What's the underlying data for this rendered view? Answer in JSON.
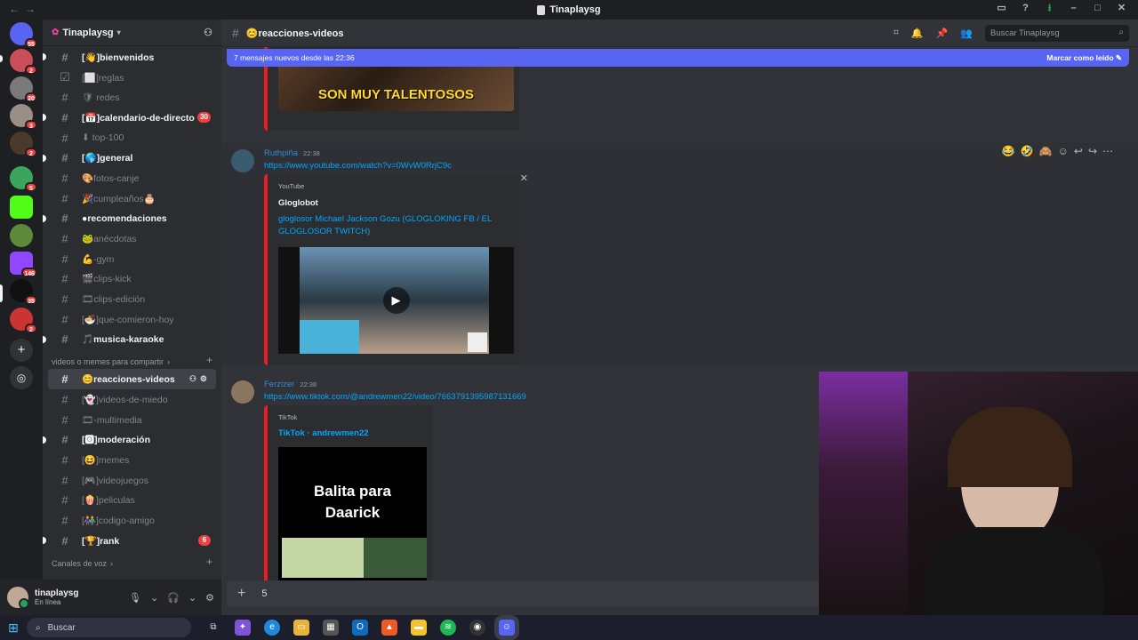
{
  "window": {
    "title": "Tinaplaysg"
  },
  "guild_badges": [
    "55",
    "2",
    "20",
    "3",
    "2",
    "5",
    "146",
    "35",
    "2"
  ],
  "server": {
    "name": "Tinaplaysg"
  },
  "channels_a": [
    {
      "name": "[👋]bienvenidos",
      "unread": true
    },
    {
      "name": "[⬜]reglas",
      "unread": false
    },
    {
      "name": "🛡 redes",
      "unread": false
    },
    {
      "name": "[📅]calendario-de-directo",
      "unread": true,
      "badge": "30"
    },
    {
      "name": "⬇ top-100",
      "unread": false
    },
    {
      "name": "[🌎]general",
      "unread": true
    },
    {
      "name": "🎨fotos-canje",
      "unread": false
    },
    {
      "name": "🎉cumpleaños🎂",
      "unread": false
    },
    {
      "name": "●recomendaciones",
      "unread": true
    },
    {
      "name": "🐸anécdotas",
      "unread": false
    },
    {
      "name": "💪-gym",
      "unread": false
    },
    {
      "name": "🎬clips-kick",
      "unread": false
    },
    {
      "name": "🎞clips-edición",
      "unread": false
    },
    {
      "name": "[🍜]que-comieron-hoy",
      "unread": false
    },
    {
      "name": "🎵musica-karaoke",
      "unread": true
    }
  ],
  "category_videos": "videos o memes para compartir",
  "channels_b": [
    {
      "name": "😊reacciones-videos",
      "active": true
    },
    {
      "name": "[👻]videos-de-miedo",
      "unread": false
    },
    {
      "name": "🎞-multimedia",
      "unread": false
    },
    {
      "name": "[🅾]moderación",
      "unread": true
    },
    {
      "name": "[😆]memes",
      "unread": false
    },
    {
      "name": "[🎮]videojuegos",
      "unread": false
    },
    {
      "name": "[🍿]peliculas",
      "unread": false
    },
    {
      "name": "[👫]codigo-amigo",
      "unread": false
    },
    {
      "name": "[🏆]rank",
      "unread": true,
      "badge": "6"
    }
  ],
  "category_voice": "Canales de voz",
  "user": {
    "name": "tinaplaysg",
    "status": "En línea"
  },
  "chat": {
    "channel": "😊reacciones-videos",
    "search_placeholder": "Buscar Tinaplaysg",
    "new_messages": "7 mensajes nuevos desde las 22:36",
    "mark_read": "Marcar como leído"
  },
  "messages": [
    {
      "author": "Ruthpiña",
      "time": "22:38",
      "link": "https://www.youtube.com/watch?v=0WvW0RrjC9c",
      "embed": {
        "provider": "YouTube",
        "author": "Gloglobot",
        "title": "gloglosor Michael Jackson Gozu (GLOGLOKING FB / EL GLOGLOSOR TWITCH)"
      }
    },
    {
      "author": "Ferzizer",
      "time": "22:38",
      "link": "https://www.tiktok.com/@andrewmen22/video/7663791395987131669",
      "embed": {
        "provider": "TikTok",
        "title": "TikTok · andrewmen22",
        "thumb_text": "Balita para Daarick"
      }
    }
  ],
  "prev_embed_caption": "SON MUY TALENTOSOS",
  "composer": {
    "value": "5"
  },
  "taskbar": {
    "search": "Buscar"
  },
  "colors": {
    "blurple": "#5865f2",
    "youtube": "#ed1c24",
    "link": "#00a8fc"
  }
}
